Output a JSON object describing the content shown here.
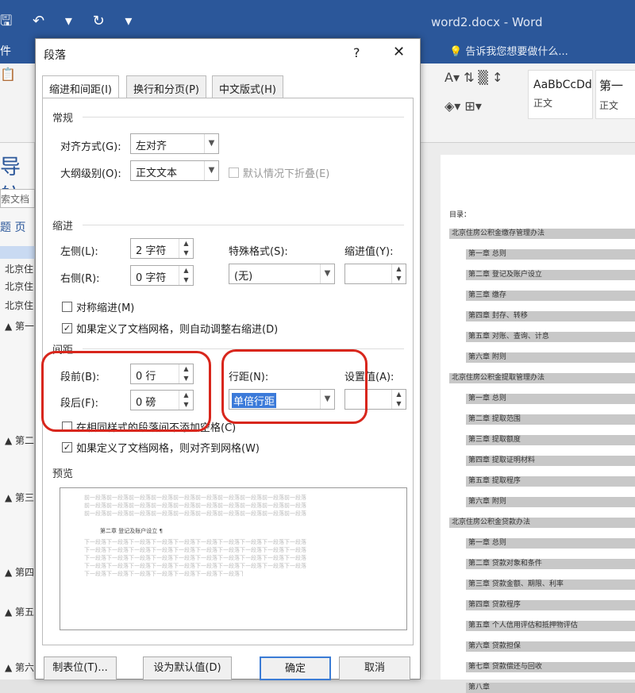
{
  "word": {
    "qat": "🖫 ↶ ▾ ↻ ▾",
    "title": "word2.docx - Word",
    "file_tab": "件",
    "tell_me": "告诉我您想要做什么...",
    "style1": "AaBbCcDd",
    "style1_name": "正文",
    "style2": "第一",
    "style2_name": "正文"
  },
  "nav": {
    "title": "导航",
    "search": "索文档",
    "tabs": "题 页",
    "items": [
      "北京住",
      "北京住",
      "北京住"
    ],
    "headings": [
      "▲ 第一",
      "▲ 第二",
      "▲ 第三",
      "▲ 第四",
      "▲ 第五",
      "▲ 第六"
    ]
  },
  "doc": {
    "toc_label": "目录：",
    "entries": [
      {
        "l": 1,
        "t": "北京住房公积金缴存管理办法"
      },
      {
        "l": 2,
        "t": "第一章 总则"
      },
      {
        "l": 2,
        "t": "第二章 登记及账户设立"
      },
      {
        "l": 2,
        "t": "第三章 缴存"
      },
      {
        "l": 2,
        "t": "第四章 封存、转移"
      },
      {
        "l": 2,
        "t": "第五章 对账、查询、计息"
      },
      {
        "l": 2,
        "t": "第六章 附则"
      },
      {
        "l": 1,
        "t": "北京住房公积金提取管理办法"
      },
      {
        "l": 2,
        "t": "第一章 总则"
      },
      {
        "l": 2,
        "t": "第二章 提取范围"
      },
      {
        "l": 2,
        "t": "第三章 提取额度"
      },
      {
        "l": 2,
        "t": "第四章 提取证明材料"
      },
      {
        "l": 2,
        "t": "第五章 提取程序"
      },
      {
        "l": 2,
        "t": "第六章 附则"
      },
      {
        "l": 1,
        "t": "北京住房公积金贷款办法"
      },
      {
        "l": 2,
        "t": "第一章 总则"
      },
      {
        "l": 2,
        "t": "第二章 贷款对象和条件"
      },
      {
        "l": 2,
        "t": "第三章 贷款金额、期限、利率"
      },
      {
        "l": 2,
        "t": "第四章 贷款程序"
      },
      {
        "l": 2,
        "t": "第五章 个人信用评估和抵押物评估"
      },
      {
        "l": 2,
        "t": "第六章 贷款担保"
      },
      {
        "l": 2,
        "t": "第七章 贷款偿还与回收"
      },
      {
        "l": 2,
        "t": "第八章"
      }
    ]
  },
  "dialog": {
    "title": "段落",
    "help": "?",
    "close": "✕",
    "tabs": [
      "缩进和间距(I)",
      "换行和分页(P)",
      "中文版式(H)"
    ],
    "general": {
      "title": "常规",
      "align_label": "对齐方式(G):",
      "align_value": "左对齐",
      "outline_label": "大纲级别(O):",
      "outline_value": "正文文本",
      "collapse_label": "默认情况下折叠(E)"
    },
    "indent": {
      "title": "缩进",
      "left_label": "左侧(L):",
      "left_value": "2 字符",
      "right_label": "右侧(R):",
      "right_value": "0 字符",
      "special_label": "特殊格式(S):",
      "special_value": "(无)",
      "by_label": "缩进值(Y):",
      "mirror_label": "对称缩进(M)",
      "auto_label": "如果定义了文档网格，则自动调整右缩进(D)"
    },
    "spacing": {
      "title": "间距",
      "before_label": "段前(B):",
      "before_value": "0 行",
      "after_label": "段后(F):",
      "after_value": "0 磅",
      "line_label": "行距(N):",
      "line_value": "单倍行距",
      "at_label": "设置值(A):",
      "nospace_label": "在相同样式的段落间不添加空格(C)",
      "grid_label": "如果定义了文档网格，则对齐到网格(W)"
    },
    "preview": {
      "title": "预览",
      "prev_text": "前一段落前一段落前一段落前一段落前一段落前一段落前一段落前一段落前一段落前一段落",
      "sample": "第二章 登记及账户设立 ¶",
      "next_text": "下一段落下一段落下一段落下一段落下一段落下一段落下一段落下一段落下一段落下一段落"
    },
    "buttons": {
      "tabs": "制表位(T)...",
      "default": "设为默认值(D)",
      "ok": "确定",
      "cancel": "取消"
    }
  }
}
